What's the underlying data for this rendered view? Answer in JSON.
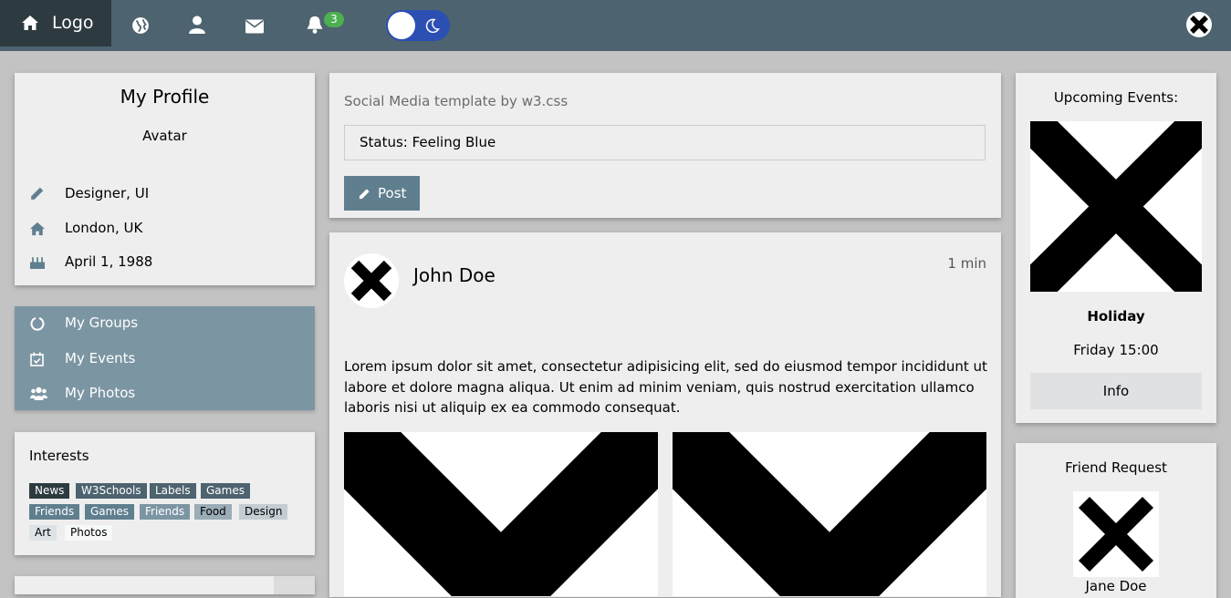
{
  "topbar": {
    "logo_label": "Logo",
    "notifications_count": "3",
    "icons": [
      "home-icon",
      "globe-icon",
      "user-icon",
      "envelope-icon",
      "bell-icon",
      "moon-icon"
    ]
  },
  "profile": {
    "title": "My Profile",
    "avatar_label": "Avatar",
    "job": "Designer, UI",
    "location": "London, UK",
    "birthday": "April 1, 1988"
  },
  "menu": {
    "items": [
      {
        "label": "My Groups",
        "icon": "circle-notch-icon"
      },
      {
        "label": "My Events",
        "icon": "calendar-check-icon"
      },
      {
        "label": "My Photos",
        "icon": "users-icon"
      }
    ]
  },
  "interests": {
    "title": "Interests",
    "tags": [
      "News",
      "W3Schools",
      "Labels",
      "Games",
      "Friends",
      "Games",
      "Friends",
      "Food",
      "Design",
      "Art",
      "Photos"
    ]
  },
  "composer": {
    "subtitle": "Social Media template by w3.css",
    "status_value": "Status: Feeling Blue",
    "post_label": "Post"
  },
  "feed": {
    "author": "John Doe",
    "time": "1 min",
    "text": "Lorem ipsum dolor sit amet, consectetur adipisicing elit, sed do eiusmod tempor incididunt ut labore et dolore magna aliqua. Ut enim ad minim veniam, quis nostrud exercitation ullamco laboris nisi ut aliquip ex ea commodo consequat."
  },
  "events": {
    "title": "Upcoming Events:",
    "name": "Holiday",
    "time": "Friday 15:00",
    "info_label": "Info"
  },
  "friend_request": {
    "title": "Friend Request",
    "name": "Jane Doe"
  },
  "colors": {
    "topbar": "#4d636f",
    "logo_bg": "#2d3a40",
    "menu_bg": "#7c95a3",
    "badge": "#4caf50",
    "toggle": "#2c4fb3"
  }
}
